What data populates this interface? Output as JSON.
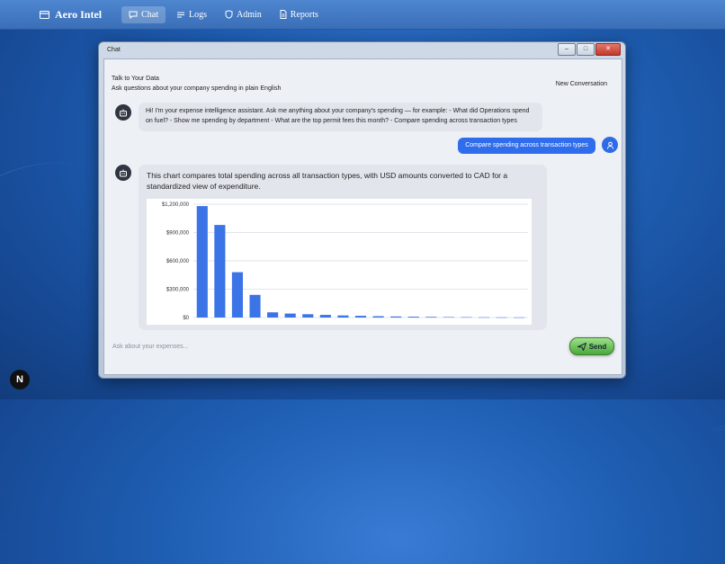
{
  "nav": {
    "brand": "Aero Intel",
    "links": [
      {
        "label": "Chat",
        "icon": "chat-icon",
        "active": true
      },
      {
        "label": "Logs",
        "icon": "logs-icon",
        "active": false
      },
      {
        "label": "Admin",
        "icon": "shield-icon",
        "active": false
      },
      {
        "label": "Reports",
        "icon": "document-icon",
        "active": false
      }
    ]
  },
  "window": {
    "title": "Chat",
    "buttons": {
      "minimize": "–",
      "maximize": "□",
      "close": "✕"
    }
  },
  "header": {
    "title": "Talk to Your Data",
    "subtitle": "Ask questions about your company spending in plain English",
    "new_conversation": "New Conversation"
  },
  "messages": {
    "greeting": "Hi! I'm your expense intelligence assistant. Ask me anything about your company's spending — for example: - What did Operations spend on fuel? - Show me spending by department - What are the top permit fees this month? - Compare spending across transaction types",
    "user_query": "Compare spending across transaction types",
    "response": "This chart compares total spending across all transaction types, with USD amounts converted to CAD for a standardized view of expenditure."
  },
  "input": {
    "placeholder": "Ask about your expenses...",
    "send_label": "Send"
  },
  "badge": {
    "label": "N"
  },
  "colors": {
    "accent": "#2f6ded",
    "bar": "#3b74e6",
    "send": "#5cbf48"
  },
  "chart_data": {
    "type": "bar",
    "ylim": [
      0,
      1200000
    ],
    "yticks": [
      0,
      300000,
      600000,
      900000,
      1200000
    ],
    "ytick_labels": [
      "$0",
      "$300,000",
      "$600,000",
      "$900,000",
      "$1,200,000"
    ],
    "values": [
      1180000,
      980000,
      480000,
      240000,
      55000,
      42000,
      35000,
      28000,
      22000,
      18000,
      14000,
      11000,
      9000,
      7000,
      5000,
      4000,
      3000,
      2000,
      1500
    ],
    "grid": true
  }
}
